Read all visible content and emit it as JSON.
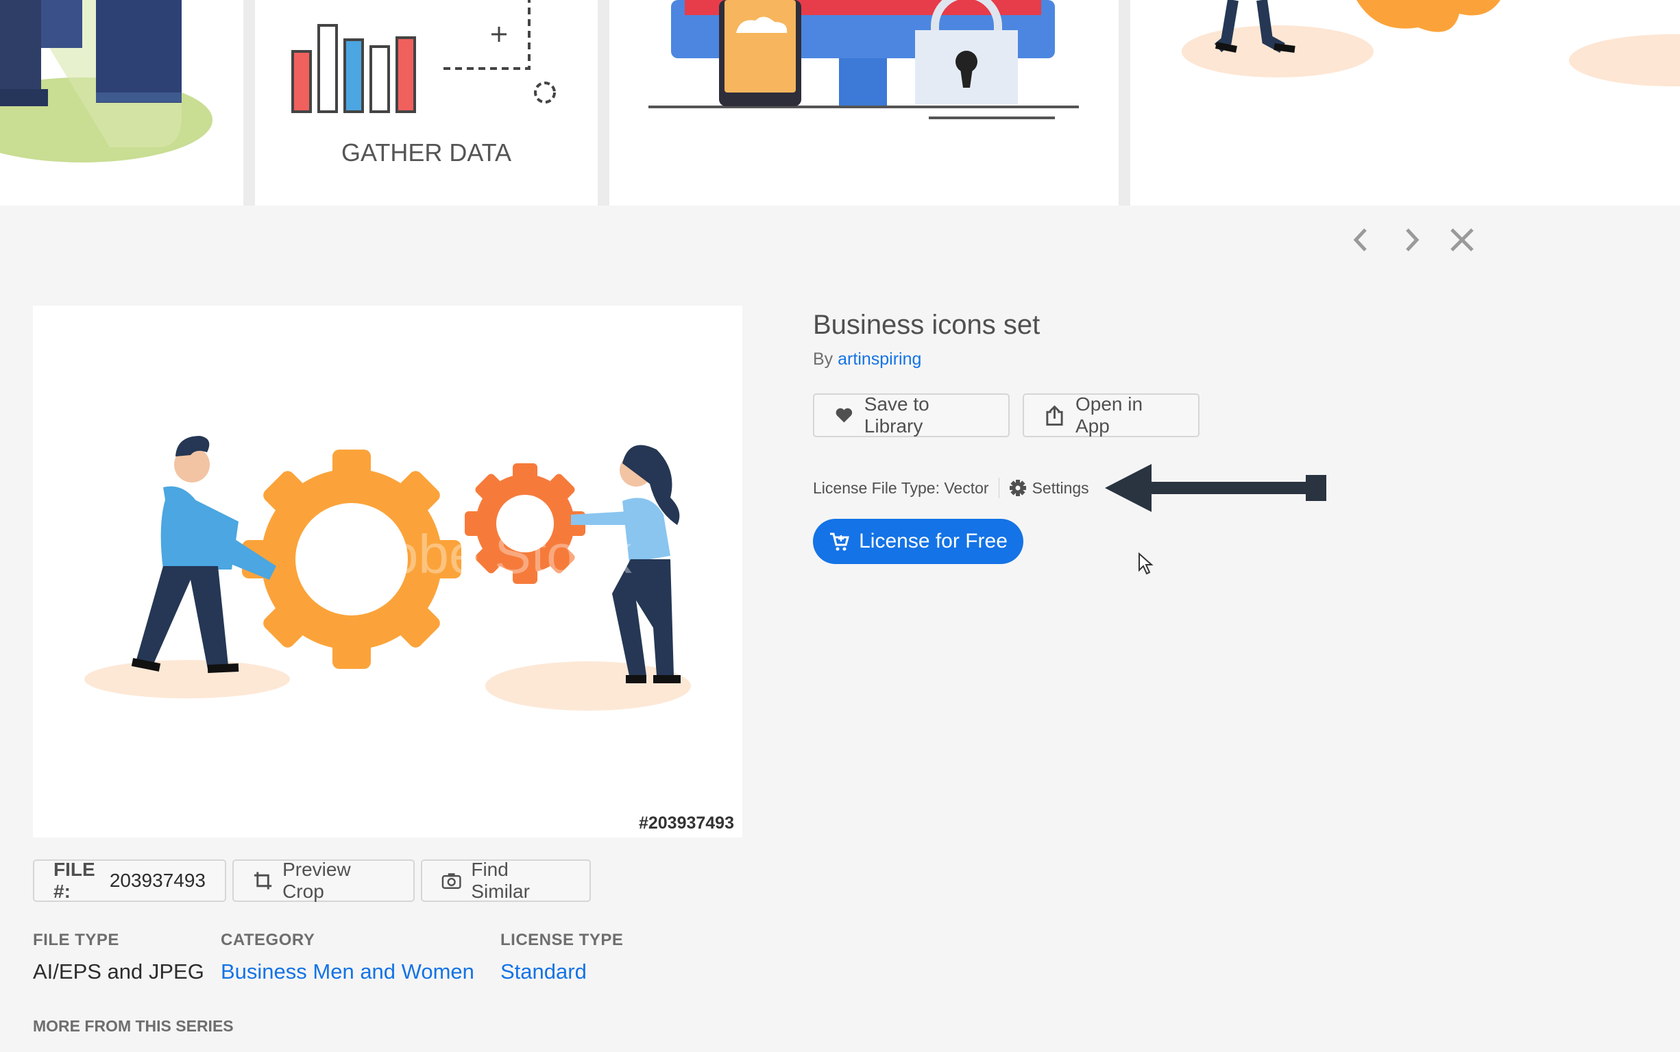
{
  "strip": {
    "thumb2_caption": "GATHER DATA"
  },
  "nav": {
    "prev_icon": "chevron-left-icon",
    "next_icon": "chevron-right-icon",
    "close_icon": "close-icon"
  },
  "preview": {
    "watermark": "Adobe Stock",
    "file_id": "#203937493"
  },
  "buttons": {
    "file_label": "FILE #:",
    "file_value": "203937493",
    "preview_crop": "Preview Crop",
    "find_similar": "Find Similar"
  },
  "meta": {
    "file_type_label": "FILE TYPE",
    "file_type_value": "AI/EPS and JPEG",
    "category_label": "CATEGORY",
    "category_value": "Business Men and Women",
    "license_type_label": "LICENSE TYPE",
    "license_type_value": "Standard"
  },
  "more_label": "MORE FROM THIS SERIES",
  "asset": {
    "title": "Business icons set",
    "by": "By",
    "author": "artinspiring"
  },
  "actions": {
    "save": "Save to Library",
    "open": "Open in App"
  },
  "license": {
    "file_type_text": "License File Type: Vector",
    "settings": "Settings",
    "cta": "License for Free"
  },
  "colors": {
    "accent": "#1473e6",
    "gear_orange": "#fba33a",
    "gear_red_orange": "#f67b3b"
  }
}
